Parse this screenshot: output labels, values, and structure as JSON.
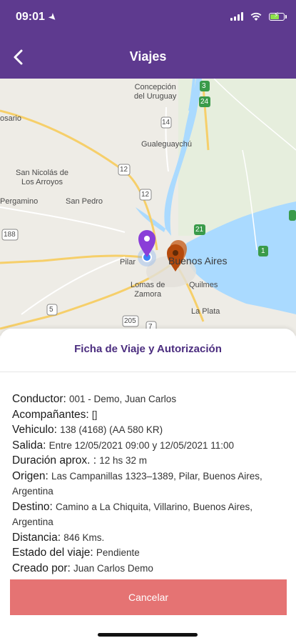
{
  "status_bar": {
    "time": "09:01"
  },
  "header": {
    "title": "Viajes"
  },
  "map": {
    "labels": {
      "concepcion": "Concepción\ndel Uruguay",
      "rosario": "osario",
      "gualeguaychu": "Gualeguaychú",
      "san_nicolas": "San Nicolás de\nLos Arroyos",
      "pergamino": "Pergamino",
      "san_pedro": "San Pedro",
      "pilar": "Pilar",
      "buenos_aires": "Buenos Aires",
      "quilmes": "Quilmes",
      "lomas": "Lomas de\nZamora",
      "la_plata": "La Plata"
    },
    "shields": {
      "r3": "3",
      "r24": "24",
      "r14": "14",
      "r12a": "12",
      "r12b": "12",
      "r21": "21",
      "r1": "1",
      "r188": "188",
      "r5": "5",
      "r205": "205",
      "r7": "7"
    },
    "colors": {
      "origin_pin": "#8a3ed8",
      "destination_pin": "#b54a0c",
      "water": "#aadaff"
    }
  },
  "sheet": {
    "title": "Ficha de Viaje y Autorización",
    "fields": [
      {
        "label": "Conductor:",
        "value": "001 - Demo, Juan Carlos"
      },
      {
        "label": "Acompañantes:",
        "value": "[]"
      },
      {
        "label": "Vehiculo:",
        "value": "138 (4168) (AA 580 KR)"
      },
      {
        "label": "Salida:",
        "value": "Entre 12/05/2021 09:00 y 12/05/2021 11:00"
      },
      {
        "label": "Duración aprox. :",
        "value": "12 hs 32 m"
      },
      {
        "label": "Origen:",
        "value": "Las Campanillas 1323–1389, Pilar, Buenos Aires, Argentina"
      },
      {
        "label": "Destino:",
        "value": "Camino a La Chiquita, Villarino, Buenos Aires, Argentina"
      },
      {
        "label": "Distancia:",
        "value": "846 Kms."
      },
      {
        "label": "Estado del viaje:",
        "value": "Pendiente"
      },
      {
        "label": "Creado por:",
        "value": "Juan Carlos Demo"
      }
    ],
    "cancel_label": "Cancelar"
  },
  "colors": {
    "header_bg": "#5e3a8f",
    "cancel_bg": "#e57373",
    "title_color": "#4b2d7f"
  }
}
